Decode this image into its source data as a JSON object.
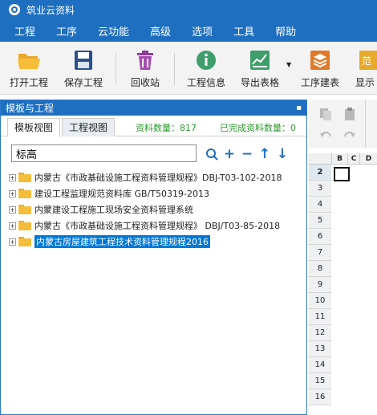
{
  "window": {
    "title": "筑业云资料"
  },
  "menu": [
    "工程",
    "工序",
    "云功能",
    "高级",
    "选项",
    "工具",
    "帮助"
  ],
  "toolbar": {
    "open": "打开工程",
    "save": "保存工程",
    "recycle": "回收站",
    "info": "工程信息",
    "export": "导出表格",
    "sequence": "工序建表",
    "show": "显示"
  },
  "panel": {
    "title": "模板与工程",
    "tab_template": "模板视图",
    "tab_project": "工程视图",
    "count_label": "资料数量：817",
    "done_label": "已完成资料数量：0",
    "search_value": "标高"
  },
  "tree": [
    {
      "label": "内蒙古《市政基础设施工程资料管理规程》DBJ-T03-102-2018"
    },
    {
      "label": "建设工程监理规范资料库 GB/T50319-2013"
    },
    {
      "label": "内蒙建设工程施工现场安全资料管理系统"
    },
    {
      "label": "内蒙古《市政基础设施工程资料管理规程》 DBJ/T03-85-2018"
    },
    {
      "label": "内蒙古房屋建筑工程技术资料管理规程2016"
    }
  ],
  "sheet": {
    "columns": [
      "B",
      "C",
      "D"
    ],
    "rows": [
      "2",
      "3",
      "4",
      "5",
      "6",
      "7",
      "8",
      "9",
      "10",
      "11",
      "12",
      "13",
      "14",
      "15",
      "16"
    ]
  },
  "colors": {
    "accent": "#1f6fc0",
    "selected": "#0078d7",
    "count": "#2c9a2c"
  }
}
